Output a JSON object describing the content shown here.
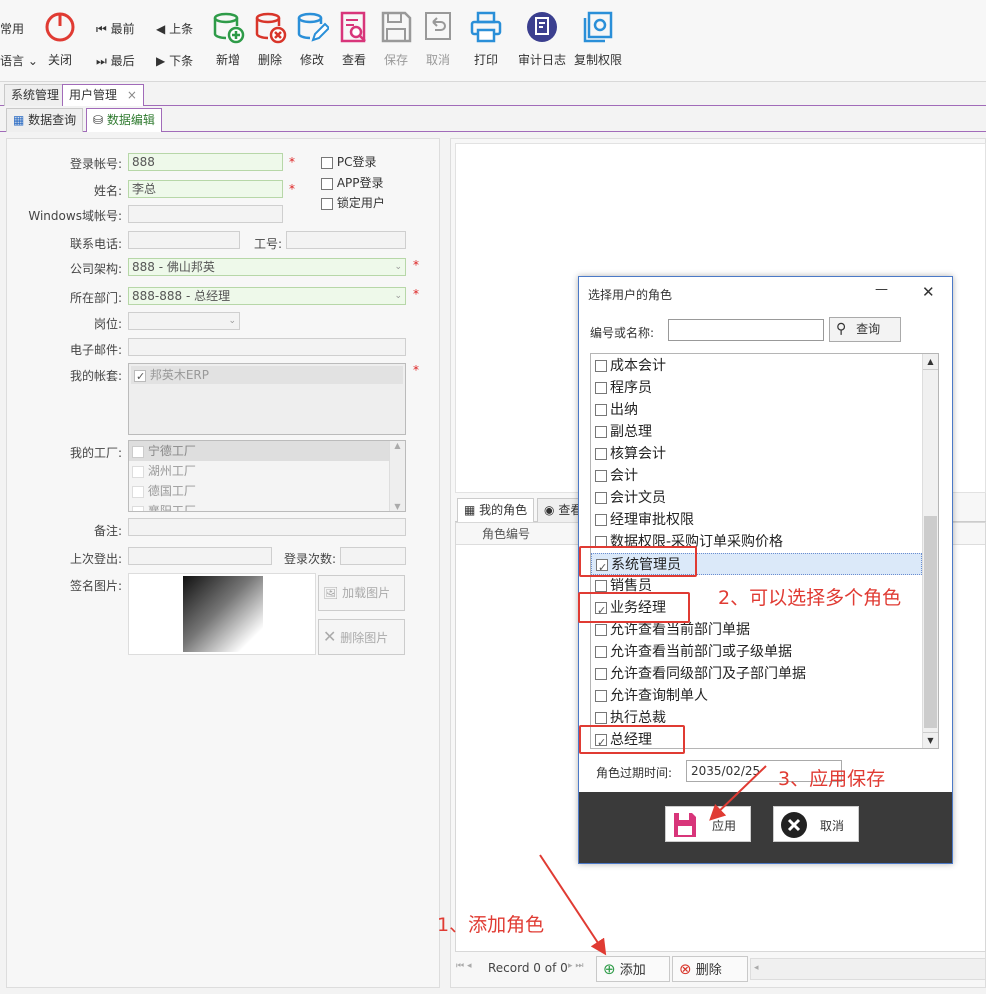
{
  "toolbar": {
    "left_top": "常用",
    "left_bottom": "语言",
    "close": "关闭",
    "first": "最前",
    "prev": "上条",
    "last": "最后",
    "next": "下条",
    "add": "新增",
    "delete": "删除",
    "edit": "修改",
    "view": "查看",
    "save": "保存",
    "cancel": "取消",
    "print": "打印",
    "audit": "审计日志",
    "copyperm": "复制权限"
  },
  "tabs": [
    "系统管理",
    "用户管理"
  ],
  "tab_close": "×",
  "subtabs": [
    "数据查询",
    "数据编辑"
  ],
  "form": {
    "login_label": "登录帐号:",
    "login_value": "888",
    "name_label": "姓名:",
    "name_value": "李总",
    "windows_label": "Windows域帐号:",
    "phone_label": "联系电话:",
    "jobno_label": "工号:",
    "company_label": "公司架构:",
    "company_value": "888 - 佛山邦英",
    "dept_label": "所在部门:",
    "dept_value": "888-888 - 总经理",
    "post_label": "岗位:",
    "email_label": "电子邮件:",
    "mybook_label": "我的帐套:",
    "mybook_item": "邦英木ERP",
    "factory_label": "我的工厂:",
    "factories": [
      "宁德工厂",
      "湖州工厂",
      "德国工厂",
      "襄阳工厂"
    ],
    "note_label": "备注:",
    "lastlogout_label": "上次登出:",
    "logincount_label": "登录次数:",
    "sign_label": "签名图片:",
    "load_img": "加载图片",
    "del_img": "删除图片",
    "pc_login": "PC登录",
    "app_login": "APP登录",
    "lock_user": "锁定用户",
    "required": "*"
  },
  "roles_grid": {
    "tab_myrole": "我的角色",
    "tab_view": "查看",
    "col_code": "角色编号"
  },
  "nav": {
    "record": "Record 0 of 0",
    "add": "添加",
    "delete": "删除"
  },
  "dialog": {
    "title": "选择用户的角色",
    "minimize": "—",
    "close": "✕",
    "search_label": "编号或名称:",
    "search_value": "",
    "search_btn": "查询",
    "roles": [
      {
        "name": "成本会计",
        "checked": false
      },
      {
        "name": "程序员",
        "checked": false
      },
      {
        "name": "出纳",
        "checked": false
      },
      {
        "name": "副总理",
        "checked": false
      },
      {
        "name": "核算会计",
        "checked": false
      },
      {
        "name": "会计",
        "checked": false
      },
      {
        "name": "会计文员",
        "checked": false
      },
      {
        "name": "经理审批权限",
        "checked": false
      },
      {
        "name": "数据权限-采购订单采购价格",
        "checked": false
      },
      {
        "name": "系统管理员",
        "checked": true
      },
      {
        "name": "销售员",
        "checked": false
      },
      {
        "name": "业务经理",
        "checked": true
      },
      {
        "name": "允许查看当前部门单据",
        "checked": false
      },
      {
        "name": "允许查看当前部门或子级单据",
        "checked": false
      },
      {
        "name": "允许查看同级部门及子部门单据",
        "checked": false
      },
      {
        "name": "允许查询制单人",
        "checked": false
      },
      {
        "name": "执行总裁",
        "checked": false
      },
      {
        "name": "总经理",
        "checked": true
      }
    ],
    "expire_label": "角色过期时间:",
    "expire_value": "2035/02/25",
    "apply": "应用",
    "cancel": "取消"
  },
  "annotations": {
    "a1": "1、添加角色",
    "a2": "2、可以选择多个角色",
    "a3": "3、应用保存"
  },
  "colors": {
    "accent": "#a16bb9",
    "annotation": "#e03b33",
    "dialog_border": "#4b79c7",
    "required": "#dd2222"
  }
}
